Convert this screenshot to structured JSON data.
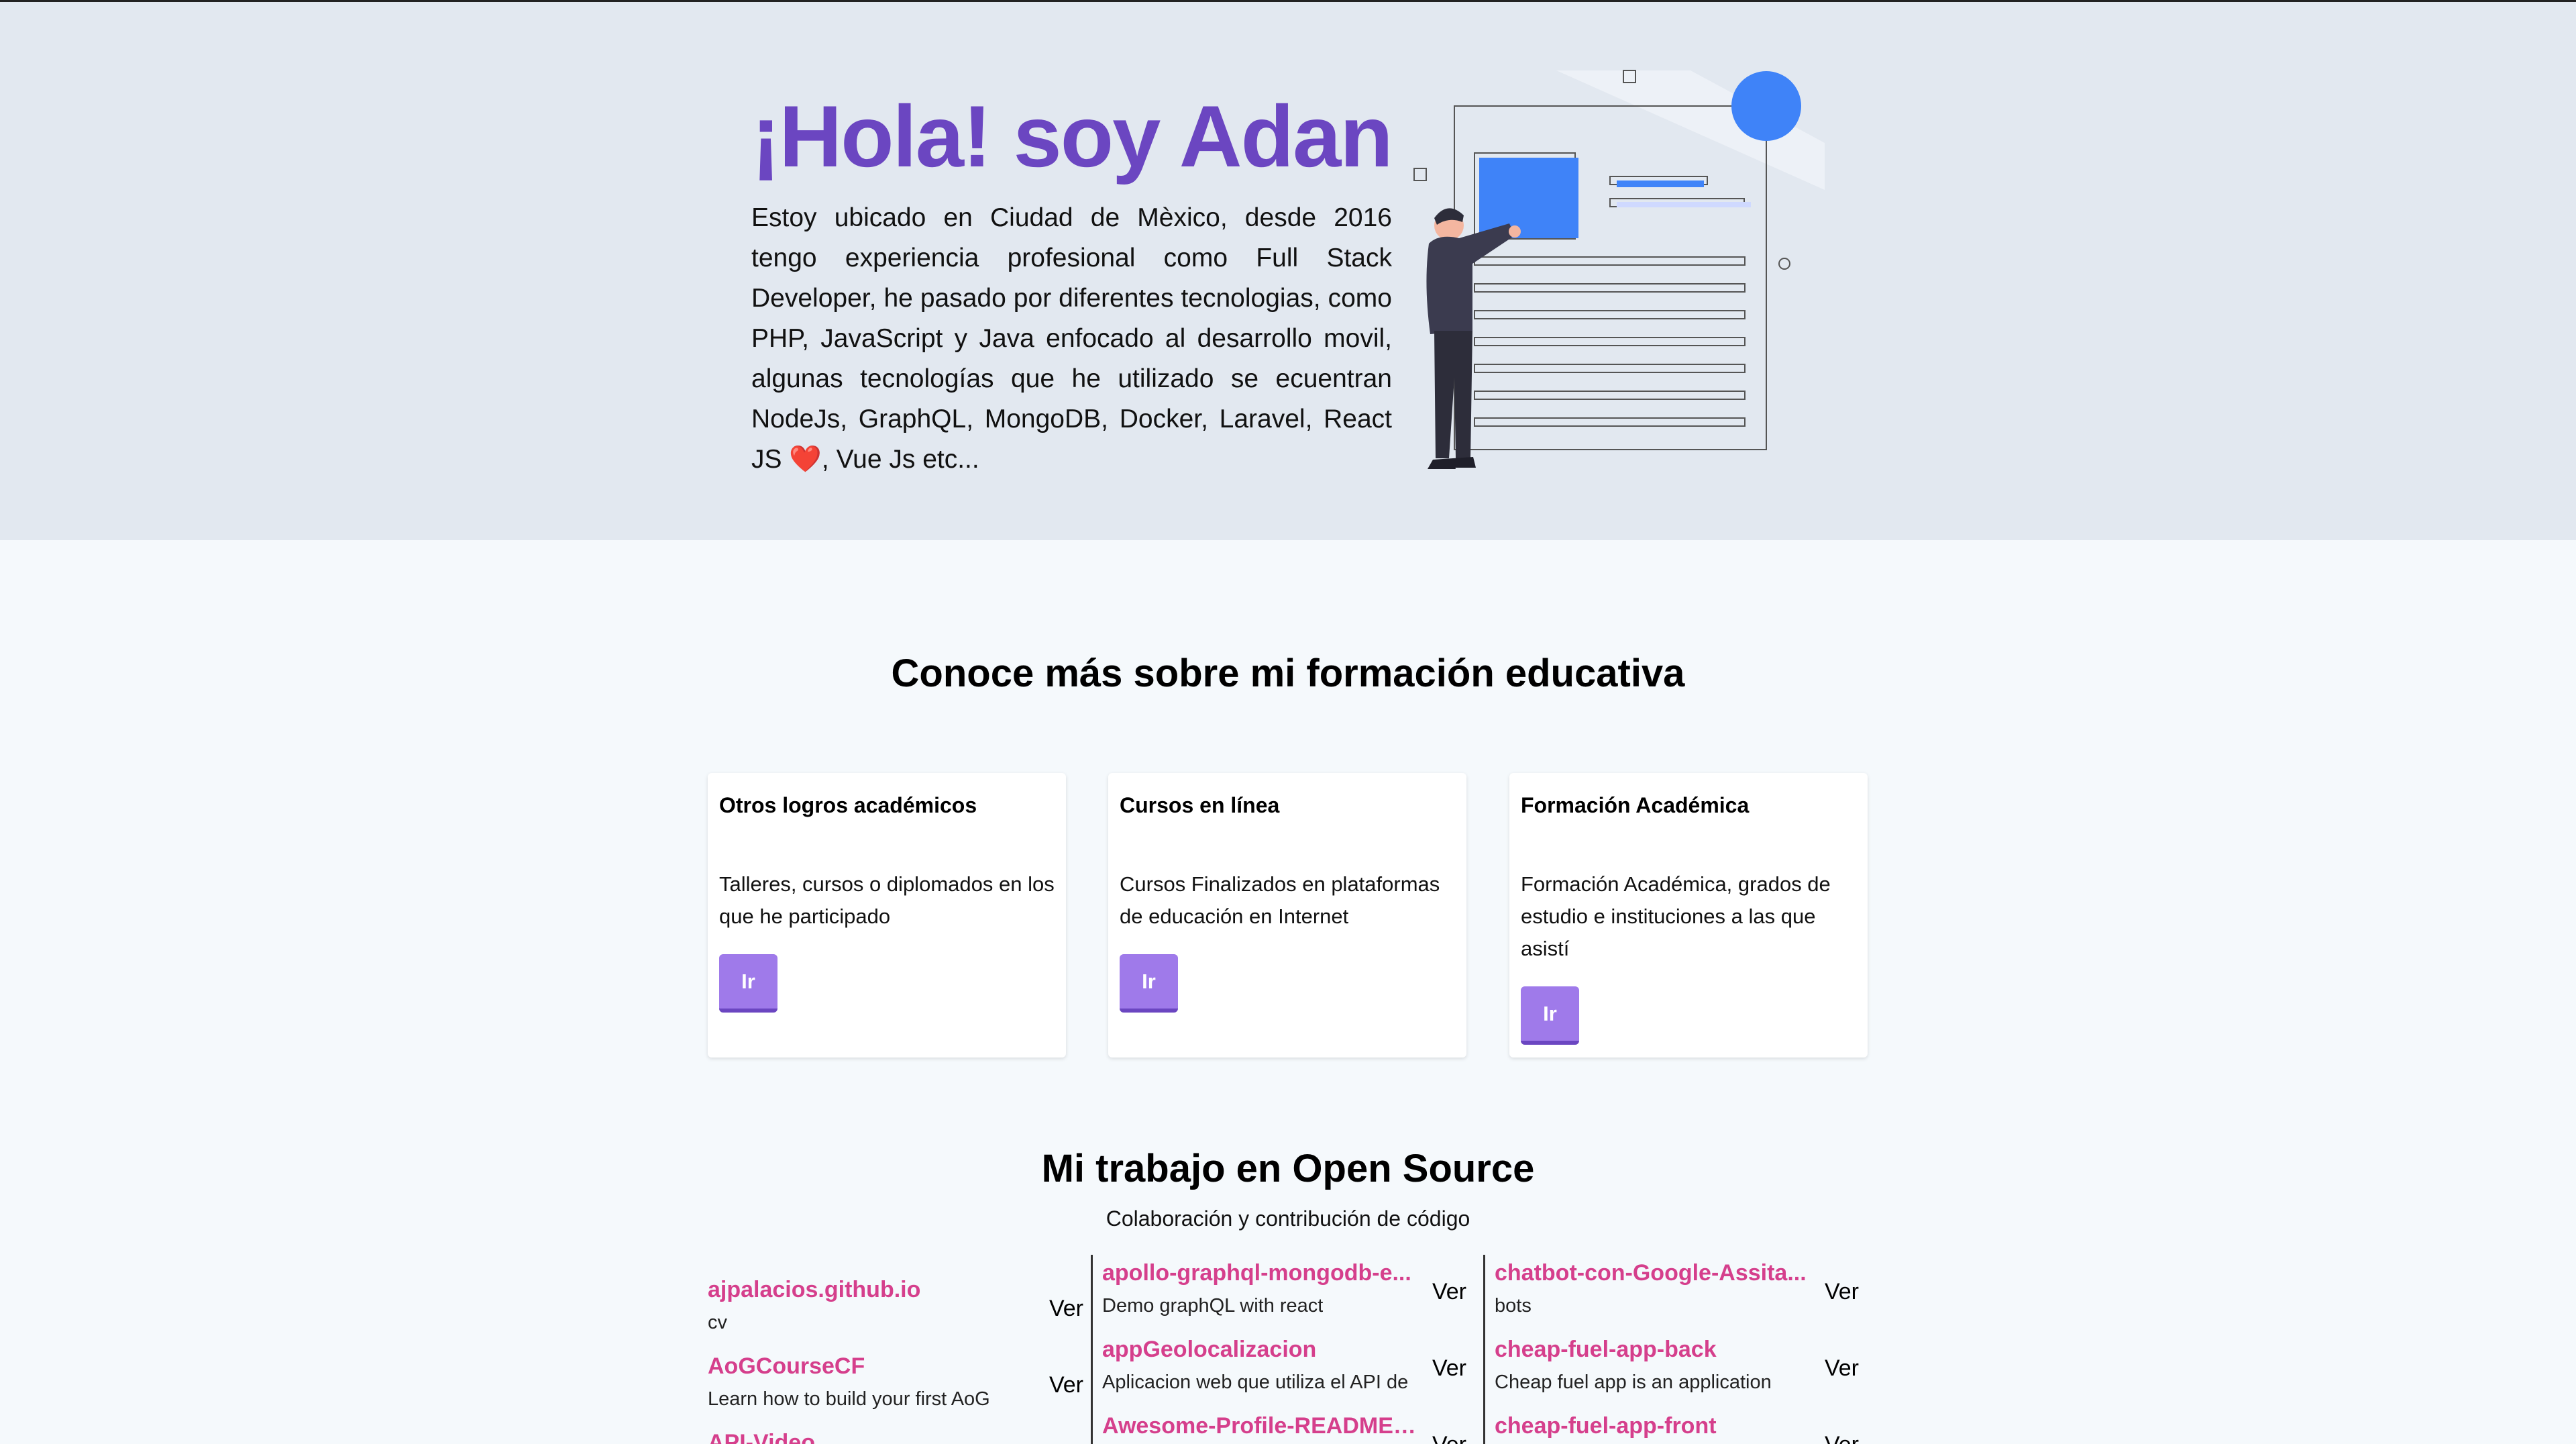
{
  "hero": {
    "title": "¡Hola! soy Adan",
    "description": "Estoy ubicado en Ciudad de Mèxico, desde 2016 tengo experiencia profesional como Full Stack Developer, he pasado por diferentes tecnologias, como PHP, JavaScript y Java enfocado al desarrollo movil, algunas tecnologías que he utilizado se ecuentran NodeJs, GraphQL, MongoDB, Docker, Laravel, React JS ❤️, Vue Js etc..."
  },
  "education": {
    "title": "Conoce más sobre mi formación educativa",
    "cards": [
      {
        "title": "Otros logros académicos",
        "description": "Talleres, cursos o diplomados en los que he participado",
        "button": "Ir"
      },
      {
        "title": "Cursos en línea",
        "description": "Cursos Finalizados en plataformas de educación en Internet",
        "button": "Ir"
      },
      {
        "title": "Formación Académica",
        "description": "Formación Académica, grados de estudio e instituciones a las que asistí",
        "button": "Ir"
      }
    ]
  },
  "opensource": {
    "title": "Mi trabajo en Open Source",
    "subtitle": "Colaboración y contribución de código",
    "ver_label": "Ver",
    "columns": [
      [
        {
          "name": "ajpalacios.github.io",
          "description": "cv"
        },
        {
          "name": "AoGCourseCF",
          "description": "Learn how to build your first AoG"
        },
        {
          "name": "API-Video",
          "description": ""
        }
      ],
      [
        {
          "name": "apollo-graphql-mongodb-e...",
          "description": "Demo graphQL with react"
        },
        {
          "name": "appGeolocalizacion",
          "description": "Aplicacion web que utiliza el API de"
        },
        {
          "name": "Awesome-Profile-README-...",
          "description": ""
        }
      ],
      [
        {
          "name": "chatbot-con-Google-Assita...",
          "description": "bots"
        },
        {
          "name": "cheap-fuel-app-back",
          "description": "Cheap fuel app is an application"
        },
        {
          "name": "cheap-fuel-app-front",
          "description": ""
        }
      ]
    ]
  },
  "colors": {
    "accent": "#6b46c1",
    "button": "#9f7aea",
    "link": "#d53f8c",
    "hero_bg": "#e2e8f0",
    "illustration_blue": "#3f83f8"
  }
}
